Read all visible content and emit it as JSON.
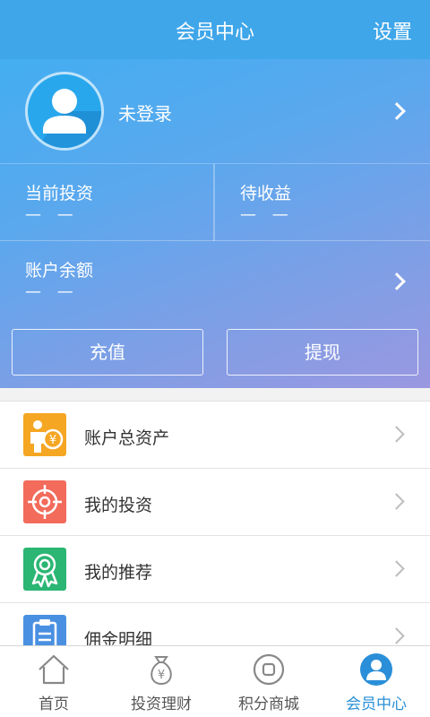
{
  "header": {
    "title": "会员中心",
    "settings_label": "设置"
  },
  "profile": {
    "login_status": "未登录",
    "avatar_icon": "user-avatar-icon"
  },
  "stats": {
    "current_investment": {
      "label": "当前投资",
      "value": "— —"
    },
    "pending_income": {
      "label": "待收益",
      "value": "— —"
    }
  },
  "balance": {
    "label": "账户余额",
    "value": "— —"
  },
  "actions": {
    "recharge_label": "充值",
    "withdraw_label": "提现"
  },
  "menu": [
    {
      "label": "账户总资产",
      "icon": "total-assets-icon",
      "color": "#f5a623"
    },
    {
      "label": "我的投资",
      "icon": "target-icon",
      "color": "#f26b5b"
    },
    {
      "label": "我的推荐",
      "icon": "award-ribbon-icon",
      "color": "#2bb673"
    },
    {
      "label": "佣金明细",
      "icon": "clipboard-icon",
      "color": "#4a90e2"
    }
  ],
  "tabs": [
    {
      "label": "首页",
      "icon": "home-icon",
      "active": false
    },
    {
      "label": "投资理财",
      "icon": "money-bag-icon",
      "active": false
    },
    {
      "label": "积分商城",
      "icon": "shop-icon",
      "active": false
    },
    {
      "label": "会员中心",
      "icon": "member-icon",
      "active": true
    }
  ],
  "colors": {
    "accent": "#3fa6ea",
    "active_tab": "#2a8fd8"
  }
}
